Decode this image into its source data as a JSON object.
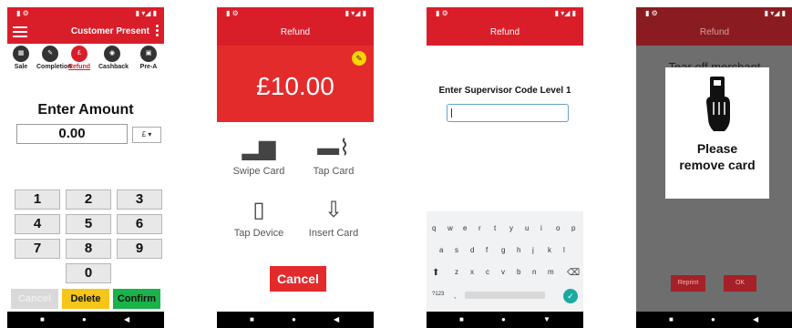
{
  "phone1": {
    "title": "Customer Present",
    "tabs": [
      {
        "icon": "sale-icon",
        "label": "Sale"
      },
      {
        "icon": "completion-icon",
        "label": "Completion"
      },
      {
        "icon": "refund-icon",
        "label": "Refund"
      },
      {
        "icon": "cashback-icon",
        "label": "Cashback"
      },
      {
        "icon": "pre-auth-icon",
        "label": "Pre-A"
      }
    ],
    "prompt": "Enter Amount",
    "amount_value": "0.00",
    "currency_symbol": "£",
    "keys": [
      "1",
      "2",
      "3",
      "4",
      "5",
      "6",
      "7",
      "8",
      "9",
      "0"
    ],
    "actions": {
      "cancel": "Cancel",
      "delete": "Delete",
      "confirm": "Confirm"
    },
    "colors": {
      "delete": "#f5c518",
      "confirm": "#19b34a",
      "cancel": "#d9d9d9"
    }
  },
  "phone2": {
    "title": "Refund",
    "amount": "£10.00",
    "options": [
      {
        "icon": "swipe-card-icon",
        "label": "Swipe Card"
      },
      {
        "icon": "tap-card-icon",
        "label": "Tap Card"
      },
      {
        "icon": "tap-device-icon",
        "label": "Tap Device"
      },
      {
        "icon": "insert-card-icon",
        "label": "Insert Card"
      }
    ],
    "cancel_label": "Cancel"
  },
  "phone3": {
    "title": "Refund",
    "prompt": "Enter Supervisor Code Level 1",
    "keyboard": {
      "row1": [
        "q",
        "w",
        "e",
        "r",
        "t",
        "y",
        "u",
        "i",
        "o",
        "p"
      ],
      "row2": [
        "a",
        "s",
        "d",
        "f",
        "g",
        "h",
        "j",
        "k",
        "l"
      ],
      "row3": [
        "z",
        "x",
        "c",
        "v",
        "b",
        "n",
        "m"
      ],
      "symbols_key": "?123"
    }
  },
  "phone4": {
    "title": "Refund",
    "background_text": "Tear off merchant",
    "message_line1": "Please",
    "message_line2": "remove card",
    "reprint_label": "Reprint",
    "ok_label": "OK"
  },
  "colors": {
    "brand_red": "#d91e2a",
    "dark_red": "#a52027"
  }
}
